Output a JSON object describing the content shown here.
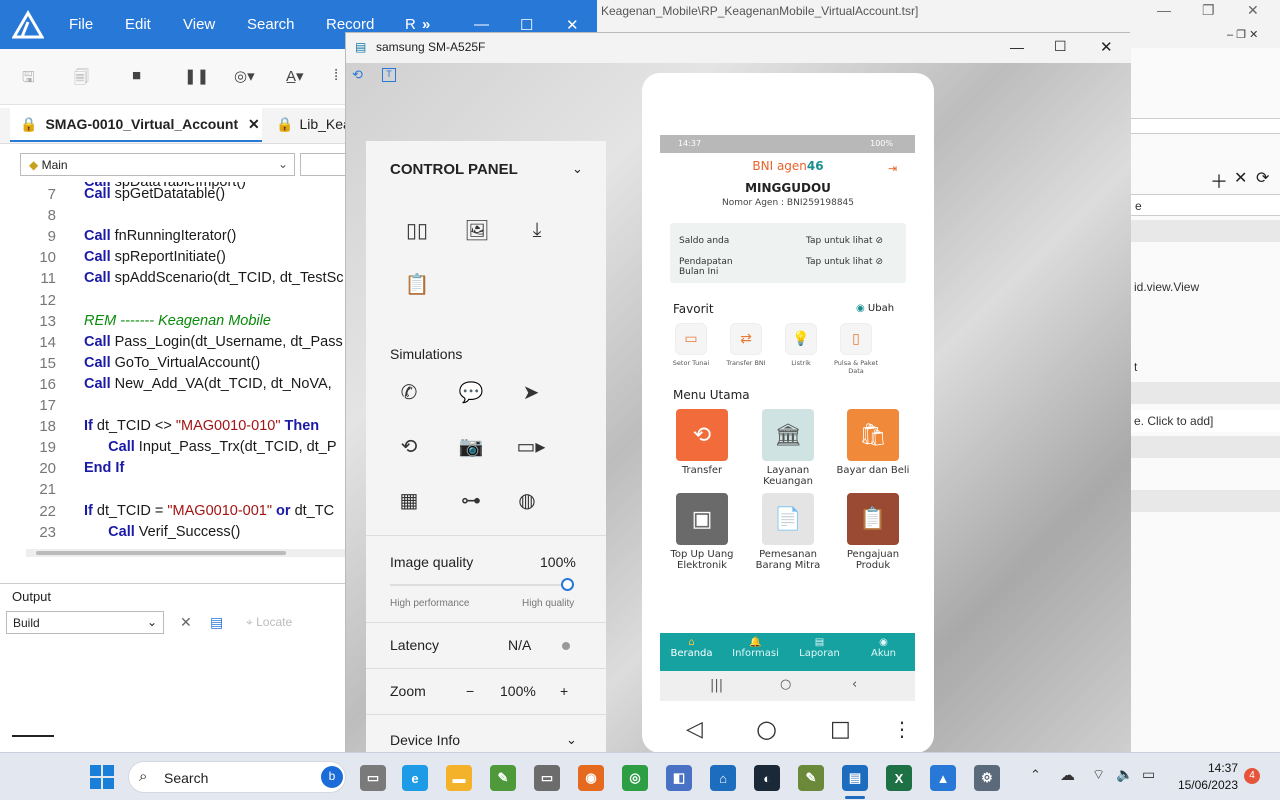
{
  "bg_window": {
    "title": "Keagenan_Mobile\\RP_KeagenanMobile_VirtualAccount.tsr]",
    "right_panel": [
      "e",
      "id.view.View",
      "t",
      "e. Click to add]"
    ]
  },
  "ide": {
    "menu": [
      "File",
      "Edit",
      "View",
      "Search",
      "Record",
      "R"
    ],
    "tabs": [
      {
        "label": "SMAG-0010_Virtual_Account",
        "active": true
      },
      {
        "label": "Lib_Kea",
        "active": false
      }
    ],
    "combo": "Main",
    "code": [
      {
        "n": "7",
        "html": "<span class='kw'>Call</span> spGetDatatable()"
      },
      {
        "n": "8",
        "html": ""
      },
      {
        "n": "9",
        "html": "<span class='kw'>Call</span> fnRunningIterator()"
      },
      {
        "n": "10",
        "html": "<span class='kw'>Call</span> spReportInitiate()"
      },
      {
        "n": "11",
        "html": "<span class='kw'>Call</span> spAddScenario(dt_TCID, dt_TestSc"
      },
      {
        "n": "12",
        "html": ""
      },
      {
        "n": "13",
        "html": "<span class='rem'>REM ------- Keagenan Mobile</span>"
      },
      {
        "n": "14",
        "html": "<span class='kw'>Call</span> Pass_Login(dt_Username, dt_Pass"
      },
      {
        "n": "15",
        "html": "<span class='kw'>Call</span> GoTo_VirtualAccount()"
      },
      {
        "n": "16",
        "html": "<span class='kw'>Call</span> New_Add_VA(dt_TCID, dt_NoVA,"
      },
      {
        "n": "17",
        "html": ""
      },
      {
        "n": "18",
        "html": "<span class='kw'>If</span> dt_TCID &lt;&gt; <span class='str'>\"MAG0010-010\"</span> <span class='kw'>Then</span>"
      },
      {
        "n": "19",
        "html": "      <span class='kw'>Call</span> Input_Pass_Trx(dt_TCID, dt_P"
      },
      {
        "n": "20",
        "html": "<span class='kw'>End If</span>"
      },
      {
        "n": "21",
        "html": ""
      },
      {
        "n": "22",
        "html": "<span class='kw'>If</span> dt_TCID = <span class='str'>\"MAG0010-001\"</span> <span class='kw'>or</span> dt_TC"
      },
      {
        "n": "23",
        "html": "      <span class='kw'>Call</span> Verif_Success()"
      }
    ],
    "output_label": "Output",
    "build_select": "Build",
    "locate_label": "Locate"
  },
  "emulator": {
    "title": "samsung SM-A525F",
    "control_panel": {
      "header": "CONTROL PANEL",
      "simulations_label": "Simulations",
      "image_quality_label": "Image quality",
      "image_quality_value": "100%",
      "high_performance": "High performance",
      "high_quality": "High quality",
      "latency_label": "Latency",
      "latency_value": "N/A",
      "zoom_label": "Zoom",
      "zoom_minus": "−",
      "zoom_value": "100%",
      "zoom_plus": "+",
      "device_info_label": "Device Info"
    }
  },
  "phone": {
    "status_time": "14:37",
    "status_right": "100%",
    "brand": "BNI agen46",
    "brand_main": "BNI agen",
    "brand_num": "46",
    "agent_name": "MINGGUDOU",
    "agent_number": "Nomor Agen : BNI259198845",
    "saldo_label": "Saldo anda",
    "pendapatan_label": "Pendapatan\nBulan Ini",
    "tap_label": "Tap untuk lihat",
    "favorit_label": "Favorit",
    "ubah_label": "Ubah",
    "favorites": [
      "Setor Tunai",
      "Transfer BNI",
      "Listrik",
      "Pulsa & Paket Data"
    ],
    "menu_label": "Menu Utama",
    "menu_items": [
      {
        "label": "Transfer",
        "color": "#f26b3a"
      },
      {
        "label": "Layanan Keuangan",
        "color": "#cfe3e3"
      },
      {
        "label": "Bayar dan Beli",
        "color": "#f08a3a"
      },
      {
        "label": "Top Up Uang Elektronik",
        "color": "#6a6a6a"
      },
      {
        "label": "Pemesanan Barang Mitra",
        "color": "#e4e4e4"
      },
      {
        "label": "Pengajuan Produk",
        "color": "#9a4a32"
      }
    ],
    "nav": [
      "Beranda",
      "Informasi",
      "Laporan",
      "Akun"
    ],
    "accent": "#17a2a2"
  },
  "taskbar": {
    "search_label": "Search",
    "time": "14:37",
    "date": "15/06/2023",
    "notif_count": "4"
  }
}
